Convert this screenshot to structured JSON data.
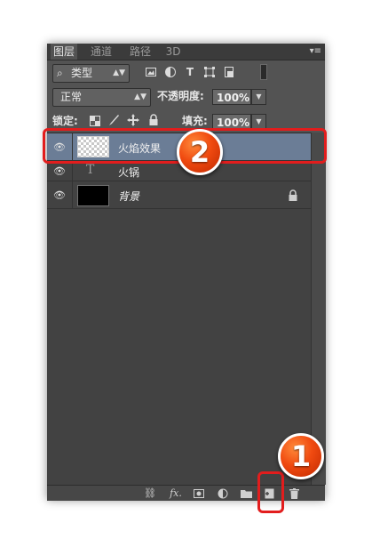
{
  "tabs": [
    {
      "label": "图层",
      "active": true
    },
    {
      "label": "通道",
      "active": false
    },
    {
      "label": "路径",
      "active": false
    },
    {
      "label": "3D",
      "active": false
    }
  ],
  "panel_menu_icon": "▾≡",
  "filter": {
    "icon": "⌕",
    "label": "类型"
  },
  "filter_icons": [
    "image-filter-icon",
    "adjustment-filter-icon",
    "type-filter-icon",
    "shape-filter-icon",
    "smart-object-filter-icon",
    "filter-toggle-icon"
  ],
  "blend": {
    "mode": "正常",
    "opacity_label": "不透明度:",
    "opacity_value": "100%"
  },
  "lock": {
    "label": "锁定:",
    "fill_label": "填充:",
    "fill_value": "100%"
  },
  "layers": [
    {
      "name": "火焰效果",
      "type": "pixel",
      "selected": true,
      "visible": true
    },
    {
      "name": "火锅",
      "type": "text",
      "selected": false,
      "visible": true
    },
    {
      "name": "背景",
      "type": "background",
      "selected": false,
      "visible": true,
      "locked": true
    }
  ],
  "bottom_icons": [
    "link-layers-icon",
    "fx-icon",
    "add-mask-icon",
    "adjustment-layer-icon",
    "new-group-icon",
    "new-layer-icon",
    "delete-layer-icon"
  ],
  "bottom_fx": "fx.",
  "annotations": {
    "step1": "1",
    "step2": "2"
  },
  "colors": {
    "panel_bg": "#535353",
    "selected_row": "#6b7d96",
    "highlight": "#e21d1d",
    "badge": "#f04a10"
  }
}
